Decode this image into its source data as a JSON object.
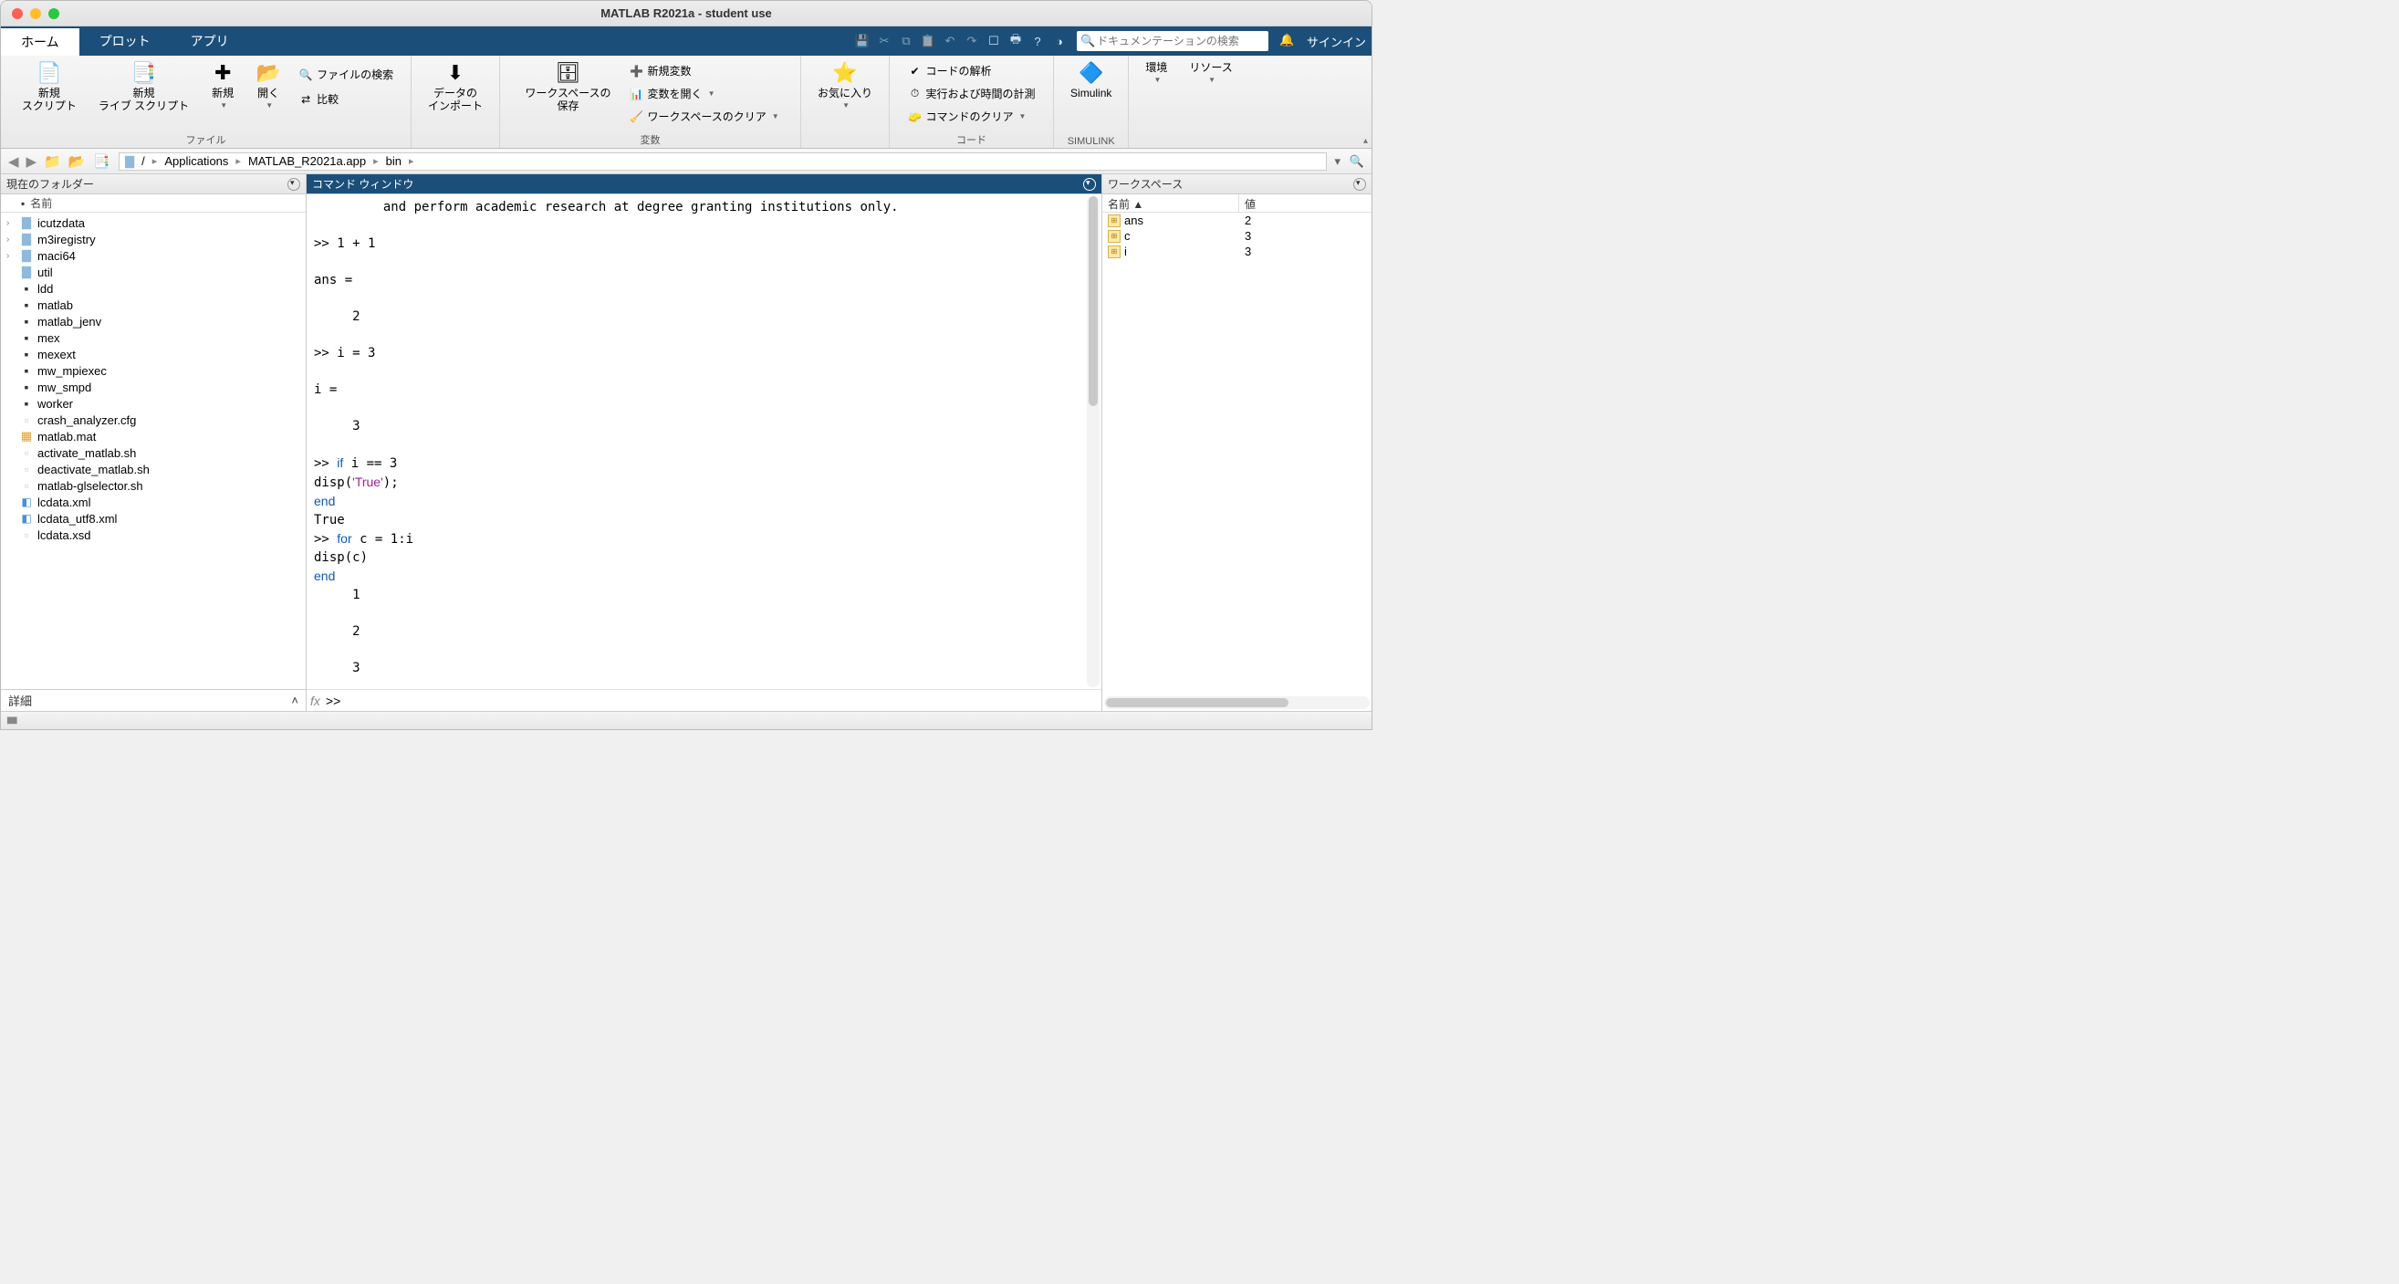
{
  "title": "MATLAB R2021a - student use",
  "tabs": [
    "ホーム",
    "プロット",
    "アプリ"
  ],
  "searchPlaceholder": "ドキュメンテーションの検索",
  "signin": "サインイン",
  "ribbon": {
    "group1": {
      "label": "ファイル",
      "newScript": "新規\nスクリプト",
      "newLive": "新規\nライブ スクリプト",
      "new": "新規",
      "open": "開く",
      "find": "ファイルの検索",
      "compare": "比較"
    },
    "group2": {
      "import": "データの\nインポート"
    },
    "group3": {
      "label": "変数",
      "save": "ワークスペースの\n保存",
      "newvar": "新規変数",
      "openvar": "変数を開く",
      "clear": "ワークスペースのクリア"
    },
    "group4": {
      "fav": "お気に入り"
    },
    "group5": {
      "label": "コード",
      "analyze": "コードの解析",
      "runtime": "実行および時間の計測",
      "clearcmd": "コマンドのクリア"
    },
    "group6": {
      "label": "SIMULINK",
      "simulink": "Simulink"
    },
    "group7": {
      "env": "環境",
      "res": "リソース"
    }
  },
  "breadcrumbs": [
    "/",
    "Applications",
    "MATLAB_R2021a.app",
    "bin"
  ],
  "folderPanel": {
    "title": "現在のフォルダー",
    "nameCol": "名前",
    "detail": "詳細",
    "items": [
      {
        "name": "icutzdata",
        "type": "folder",
        "expandable": true
      },
      {
        "name": "m3iregistry",
        "type": "folder",
        "expandable": true
      },
      {
        "name": "maci64",
        "type": "folder",
        "expandable": true
      },
      {
        "name": "util",
        "type": "folder",
        "expandable": false
      },
      {
        "name": "ldd",
        "type": "bin"
      },
      {
        "name": "matlab",
        "type": "bin"
      },
      {
        "name": "matlab_jenv",
        "type": "bin"
      },
      {
        "name": "mex",
        "type": "bin"
      },
      {
        "name": "mexext",
        "type": "bin"
      },
      {
        "name": "mw_mpiexec",
        "type": "bin"
      },
      {
        "name": "mw_smpd",
        "type": "bin"
      },
      {
        "name": "worker",
        "type": "bin"
      },
      {
        "name": "crash_analyzer.cfg",
        "type": "txt"
      },
      {
        "name": "matlab.mat",
        "type": "mat"
      },
      {
        "name": "activate_matlab.sh",
        "type": "txt"
      },
      {
        "name": "deactivate_matlab.sh",
        "type": "txt"
      },
      {
        "name": "matlab-glselector.sh",
        "type": "txt"
      },
      {
        "name": "lcdata.xml",
        "type": "xml"
      },
      {
        "name": "lcdata_utf8.xml",
        "type": "xml"
      },
      {
        "name": "lcdata.xsd",
        "type": "txt"
      }
    ]
  },
  "cmdWindow": {
    "title": "コマンド ウィンドウ",
    "prompt": ">> "
  },
  "workspace": {
    "title": "ワークスペース",
    "nameCol": "名前 ▲",
    "valCol": "値",
    "vars": [
      {
        "name": "ans",
        "value": "2"
      },
      {
        "name": "c",
        "value": "3"
      },
      {
        "name": "i",
        "value": "3"
      }
    ]
  }
}
